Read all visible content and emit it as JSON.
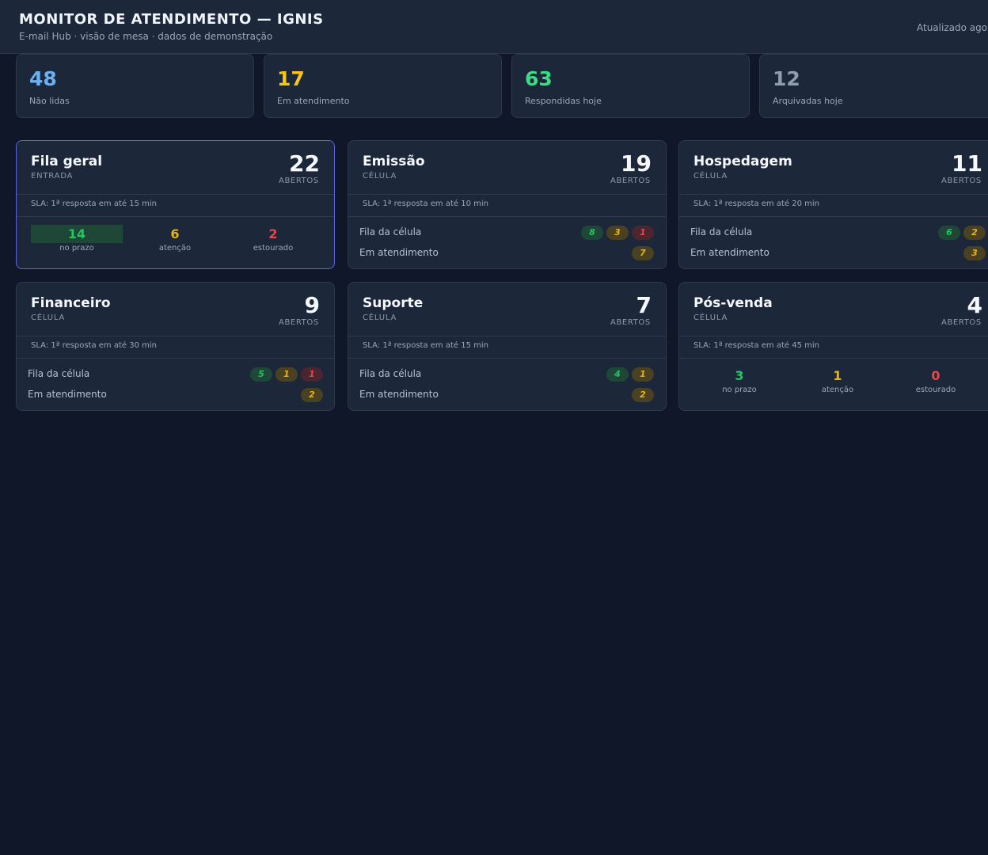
{
  "header": {
    "title": "MONITOR DE ATENDIMENTO — IGNIS",
    "subtitle": "E-mail Hub · visão de mesa · dados de demonstração",
    "updated": "Atualizado agora"
  },
  "stats": [
    {
      "value": "48",
      "label": "Não lidas",
      "color": "#6ab0f5"
    },
    {
      "value": "17",
      "label": "Em atendimento",
      "color": "#f5c518"
    },
    {
      "value": "63",
      "label": "Respondidas hoje",
      "color": "#3ddc84"
    },
    {
      "value": "12",
      "label": "Arquivadas hoje",
      "color": "#8f9db3"
    }
  ],
  "open_label": "ABERTOS",
  "row_labels": {
    "queue": "Fila da célula",
    "in_service": "Em atendimento"
  },
  "sla_labels": {
    "on_time": "no prazo",
    "attention": "atenção",
    "breached": "estourado"
  },
  "colors": {
    "on_time": "#22c55e",
    "attention": "#eab308",
    "breached": "#ef4444",
    "highlight_border": "#5b63e0"
  },
  "cards": [
    {
      "name": "Fila geral",
      "kind": "ENTRADA",
      "count": "22",
      "sla": "SLA: 1ª resposta em até 15 min",
      "on_time": "14",
      "attention": "6",
      "breached": "2"
    },
    {
      "name": "Emissão",
      "kind": "CÉLULA",
      "count": "19",
      "sla": "SLA: 1ª resposta em até 10 min",
      "queue": [
        "8",
        "3",
        "1"
      ],
      "in_service": "7"
    },
    {
      "name": "Hospedagem",
      "kind": "CÉLULA",
      "count": "11",
      "sla": "SLA: 1ª resposta em até 20 min",
      "queue": [
        "6",
        "2"
      ],
      "in_service": "3"
    },
    {
      "name": "Financeiro",
      "kind": "CÉLULA",
      "count": "9",
      "sla": "SLA: 1ª resposta em até 30 min",
      "queue": [
        "5",
        "1",
        "1"
      ],
      "in_service": "2"
    },
    {
      "name": "Suporte",
      "kind": "CÉLULA",
      "count": "7",
      "sla": "SLA: 1ª resposta em até 15 min",
      "queue": [
        "4",
        "1"
      ],
      "in_service": "2"
    },
    {
      "name": "Pós-venda",
      "kind": "CÉLULA",
      "count": "4",
      "sla": "SLA: 1ª resposta em até 45 min",
      "on_time": "3",
      "attention": "1",
      "breached": "0"
    }
  ]
}
